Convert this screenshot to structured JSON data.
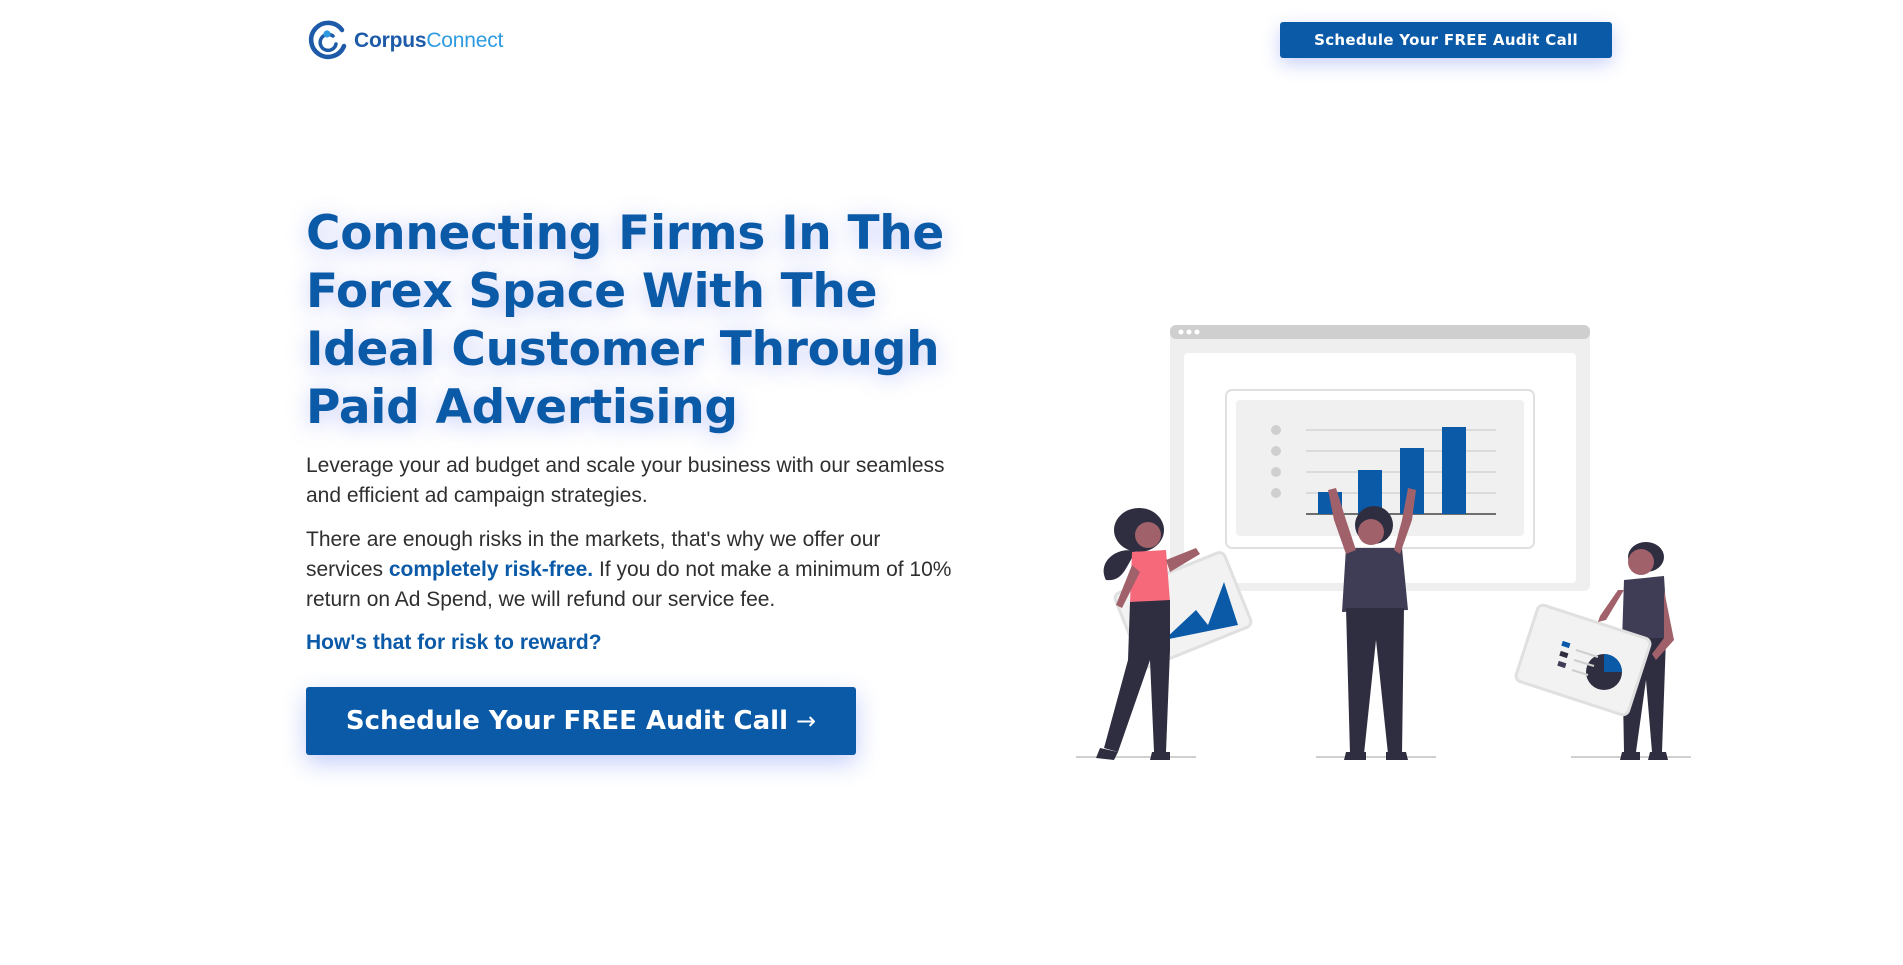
{
  "brand": {
    "name_part1": "Corpus",
    "name_part2": "Connect",
    "logo_icon": "corpusconnect-logo-icon",
    "primary_color": "#0a5aa8",
    "accent_color": "#2e9be0"
  },
  "header": {
    "cta_label": "Schedule Your FREE Audit Call"
  },
  "hero": {
    "headline": "Connecting Firms In The Forex Space With The Ideal Customer Through Paid Advertising",
    "paragraph1": "Leverage your ad budget and scale your business with our seamless and efficient ad campaign strategies.",
    "paragraph2_before": "There are enough risks in the markets, that's why we offer our services ",
    "paragraph2_highlight": "completely risk-free.",
    "paragraph2_after": " If you do not make a minimum of 10% return on Ad Spend, we will refund our service fee.",
    "tagline": "How's that for risk to reward?",
    "cta_label": "Schedule Your FREE Audit Call",
    "cta_arrow": "→"
  },
  "illustration": {
    "icon": "analytics-team-illustration"
  }
}
